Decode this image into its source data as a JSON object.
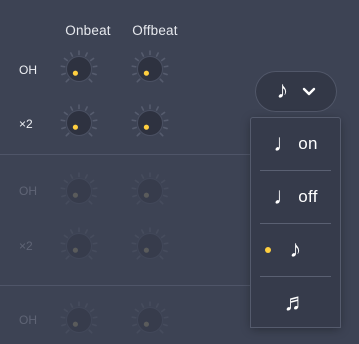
{
  "columns": {
    "onbeat": "Onbeat",
    "offbeat": "Offbeat"
  },
  "rows": [
    {
      "label": "OH"
    },
    {
      "label": "×2"
    },
    {
      "label": "OH"
    },
    {
      "label": "×2"
    },
    {
      "label": "OH"
    }
  ],
  "selector": {
    "value": "♪"
  },
  "menu": {
    "items": [
      {
        "glyph": "♩",
        "suffix": "on"
      },
      {
        "glyph": "♩",
        "suffix": "off"
      },
      {
        "glyph": "♪",
        "suffix": ""
      },
      {
        "glyph": "♬",
        "suffix": ""
      }
    ],
    "selected_index": 2
  },
  "colors": {
    "accent": "#ffcf3f",
    "background": "#3d4354",
    "menu": "#363b4b"
  }
}
